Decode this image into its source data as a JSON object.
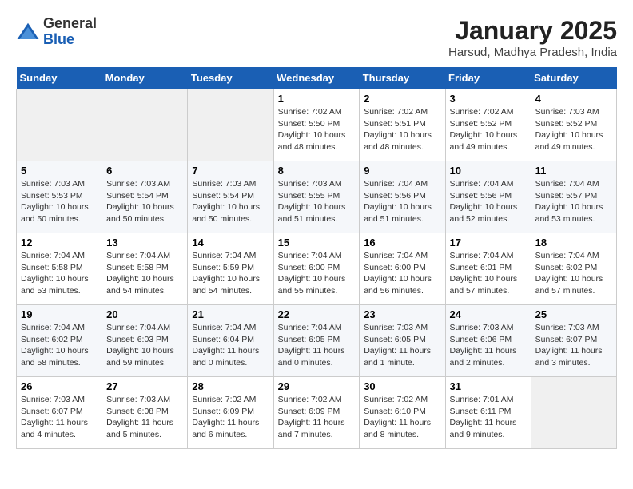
{
  "header": {
    "logo": {
      "general": "General",
      "blue": "Blue"
    },
    "title": "January 2025",
    "subtitle": "Harsud, Madhya Pradesh, India"
  },
  "weekdays": [
    "Sunday",
    "Monday",
    "Tuesday",
    "Wednesday",
    "Thursday",
    "Friday",
    "Saturday"
  ],
  "weeks": [
    [
      {
        "day": "",
        "info": ""
      },
      {
        "day": "",
        "info": ""
      },
      {
        "day": "",
        "info": ""
      },
      {
        "day": "1",
        "info": "Sunrise: 7:02 AM\nSunset: 5:50 PM\nDaylight: 10 hours\nand 48 minutes."
      },
      {
        "day": "2",
        "info": "Sunrise: 7:02 AM\nSunset: 5:51 PM\nDaylight: 10 hours\nand 48 minutes."
      },
      {
        "day": "3",
        "info": "Sunrise: 7:02 AM\nSunset: 5:52 PM\nDaylight: 10 hours\nand 49 minutes."
      },
      {
        "day": "4",
        "info": "Sunrise: 7:03 AM\nSunset: 5:52 PM\nDaylight: 10 hours\nand 49 minutes."
      }
    ],
    [
      {
        "day": "5",
        "info": "Sunrise: 7:03 AM\nSunset: 5:53 PM\nDaylight: 10 hours\nand 50 minutes."
      },
      {
        "day": "6",
        "info": "Sunrise: 7:03 AM\nSunset: 5:54 PM\nDaylight: 10 hours\nand 50 minutes."
      },
      {
        "day": "7",
        "info": "Sunrise: 7:03 AM\nSunset: 5:54 PM\nDaylight: 10 hours\nand 50 minutes."
      },
      {
        "day": "8",
        "info": "Sunrise: 7:03 AM\nSunset: 5:55 PM\nDaylight: 10 hours\nand 51 minutes."
      },
      {
        "day": "9",
        "info": "Sunrise: 7:04 AM\nSunset: 5:56 PM\nDaylight: 10 hours\nand 51 minutes."
      },
      {
        "day": "10",
        "info": "Sunrise: 7:04 AM\nSunset: 5:56 PM\nDaylight: 10 hours\nand 52 minutes."
      },
      {
        "day": "11",
        "info": "Sunrise: 7:04 AM\nSunset: 5:57 PM\nDaylight: 10 hours\nand 53 minutes."
      }
    ],
    [
      {
        "day": "12",
        "info": "Sunrise: 7:04 AM\nSunset: 5:58 PM\nDaylight: 10 hours\nand 53 minutes."
      },
      {
        "day": "13",
        "info": "Sunrise: 7:04 AM\nSunset: 5:58 PM\nDaylight: 10 hours\nand 54 minutes."
      },
      {
        "day": "14",
        "info": "Sunrise: 7:04 AM\nSunset: 5:59 PM\nDaylight: 10 hours\nand 54 minutes."
      },
      {
        "day": "15",
        "info": "Sunrise: 7:04 AM\nSunset: 6:00 PM\nDaylight: 10 hours\nand 55 minutes."
      },
      {
        "day": "16",
        "info": "Sunrise: 7:04 AM\nSunset: 6:00 PM\nDaylight: 10 hours\nand 56 minutes."
      },
      {
        "day": "17",
        "info": "Sunrise: 7:04 AM\nSunset: 6:01 PM\nDaylight: 10 hours\nand 57 minutes."
      },
      {
        "day": "18",
        "info": "Sunrise: 7:04 AM\nSunset: 6:02 PM\nDaylight: 10 hours\nand 57 minutes."
      }
    ],
    [
      {
        "day": "19",
        "info": "Sunrise: 7:04 AM\nSunset: 6:02 PM\nDaylight: 10 hours\nand 58 minutes."
      },
      {
        "day": "20",
        "info": "Sunrise: 7:04 AM\nSunset: 6:03 PM\nDaylight: 10 hours\nand 59 minutes."
      },
      {
        "day": "21",
        "info": "Sunrise: 7:04 AM\nSunset: 6:04 PM\nDaylight: 11 hours\nand 0 minutes."
      },
      {
        "day": "22",
        "info": "Sunrise: 7:04 AM\nSunset: 6:05 PM\nDaylight: 11 hours\nand 0 minutes."
      },
      {
        "day": "23",
        "info": "Sunrise: 7:03 AM\nSunset: 6:05 PM\nDaylight: 11 hours\nand 1 minute."
      },
      {
        "day": "24",
        "info": "Sunrise: 7:03 AM\nSunset: 6:06 PM\nDaylight: 11 hours\nand 2 minutes."
      },
      {
        "day": "25",
        "info": "Sunrise: 7:03 AM\nSunset: 6:07 PM\nDaylight: 11 hours\nand 3 minutes."
      }
    ],
    [
      {
        "day": "26",
        "info": "Sunrise: 7:03 AM\nSunset: 6:07 PM\nDaylight: 11 hours\nand 4 minutes."
      },
      {
        "day": "27",
        "info": "Sunrise: 7:03 AM\nSunset: 6:08 PM\nDaylight: 11 hours\nand 5 minutes."
      },
      {
        "day": "28",
        "info": "Sunrise: 7:02 AM\nSunset: 6:09 PM\nDaylight: 11 hours\nand 6 minutes."
      },
      {
        "day": "29",
        "info": "Sunrise: 7:02 AM\nSunset: 6:09 PM\nDaylight: 11 hours\nand 7 minutes."
      },
      {
        "day": "30",
        "info": "Sunrise: 7:02 AM\nSunset: 6:10 PM\nDaylight: 11 hours\nand 8 minutes."
      },
      {
        "day": "31",
        "info": "Sunrise: 7:01 AM\nSunset: 6:11 PM\nDaylight: 11 hours\nand 9 minutes."
      },
      {
        "day": "",
        "info": ""
      }
    ]
  ]
}
